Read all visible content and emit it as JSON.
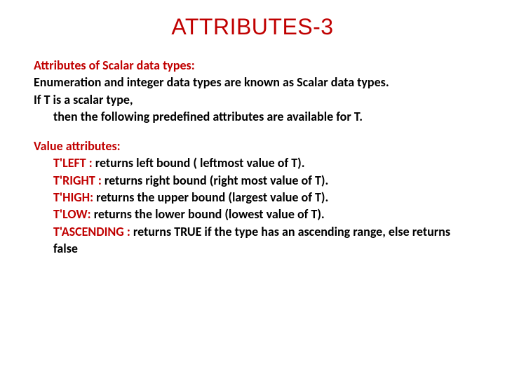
{
  "title": "ATTRIBUTES-3",
  "section1": {
    "heading": "Attributes of Scalar data types:",
    "line1": "Enumeration and integer data types are known as Scalar data types.",
    "line2": "If T is a scalar  type,",
    "line3": "then the following predefined attributes are available for T."
  },
  "section2": {
    "heading": "Value attributes:",
    "items": [
      {
        "label": "T'LEFT :",
        "text": " returns left bound ( leftmost value of T)."
      },
      {
        "label": "T'RIGHT :",
        "text": " returns right  bound (right most value of T)."
      },
      {
        "label": "T'HIGH:",
        "text": " returns  the upper bound (largest value of T)."
      },
      {
        "label": "T'LOW:",
        "text": " returns  the lower bound (lowest value of T)."
      },
      {
        "label": "T'ASCENDING :",
        "text": " returns TRUE if the type has an ascending range, else returns false"
      }
    ]
  }
}
